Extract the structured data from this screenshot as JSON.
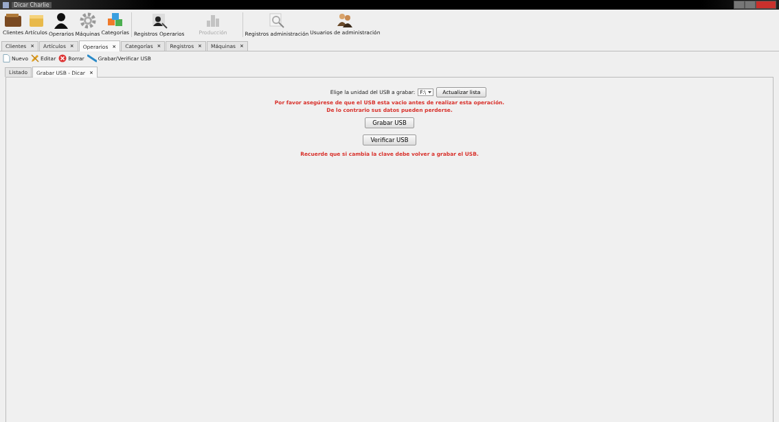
{
  "window": {
    "title": "Dicar Charlie"
  },
  "toolbar": {
    "groups": [
      [
        {
          "label": "Clientes",
          "kind": "wallet",
          "disabled": false
        },
        {
          "label": "Artículos",
          "kind": "box",
          "disabled": false
        },
        {
          "label": "Operarios",
          "kind": "person",
          "disabled": false
        },
        {
          "label": "Máquinas",
          "kind": "gear",
          "disabled": false
        },
        {
          "label": "Categorías",
          "kind": "cubes",
          "disabled": false
        }
      ],
      [
        {
          "label": "Registros Operarios",
          "kind": "person-search",
          "disabled": false
        },
        {
          "label": "Producción",
          "kind": "chart",
          "disabled": true
        }
      ],
      [
        {
          "label": "Registros administración",
          "kind": "search",
          "disabled": false
        },
        {
          "label": "Usuarios de administración",
          "kind": "people",
          "disabled": false
        }
      ]
    ]
  },
  "tabs": [
    {
      "label": "Clientes",
      "close": "×",
      "selected": false
    },
    {
      "label": "Artículos",
      "close": "×",
      "selected": false
    },
    {
      "label": "Operarios",
      "close": "×",
      "selected": true
    },
    {
      "label": "Categorías",
      "close": "×",
      "selected": false
    },
    {
      "label": "Registros",
      "close": "×",
      "selected": false
    },
    {
      "label": "Máquinas",
      "close": "×",
      "selected": false
    }
  ],
  "actions": [
    {
      "label": "Nuevo",
      "kind": "page"
    },
    {
      "label": "Editar",
      "kind": "pencil"
    },
    {
      "label": "Borrar",
      "kind": "delete"
    },
    {
      "label": "Grabar/Verificar USB",
      "kind": "usb"
    }
  ],
  "subtabs": [
    {
      "label": "Listado",
      "selected": false
    },
    {
      "label": "Grabar USB - Dicar",
      "close": "×",
      "selected": true
    }
  ],
  "panel": {
    "drive_label": "Elige la unidad del USB a grabar:",
    "drive_value": "F:\\",
    "refresh_button": "Actualizar lista",
    "warning_lines": [
      "Por favor asegúrese de que el USB esta vacio antes de realizar esta operación.",
      "De lo contrario sus datos pueden perderse."
    ],
    "write_button": "Grabar USB",
    "verify_button": "Verificar USB",
    "reminder": "Recuerde que si cambia la clave debe volver a grabar el USB."
  }
}
